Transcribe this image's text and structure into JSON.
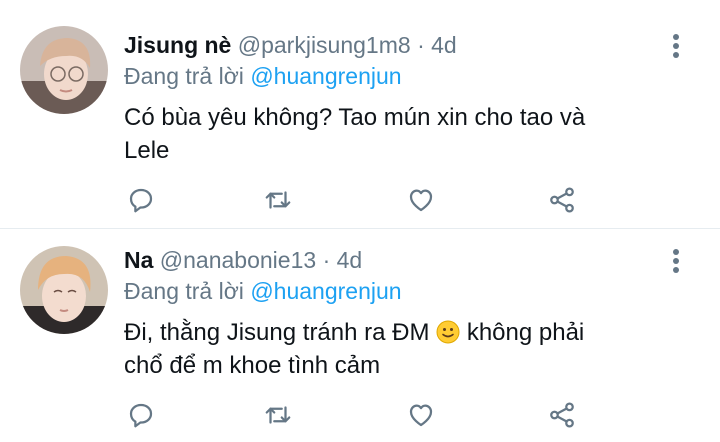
{
  "tweets": [
    {
      "display_name": "Jisung nè",
      "handle": "@parkjisung1m8",
      "separator": "·",
      "time": "4d",
      "reply_prefix": "Đang trả lời",
      "reply_to": "@huangrenjun",
      "text_lines": [
        "Có bùa yêu không? Tao mún xin cho tao và",
        "Lele"
      ],
      "avatar_icon": "avatar-photo"
    },
    {
      "display_name": "Na",
      "handle": "@nanabonie13",
      "separator": "·",
      "time": "4d",
      "reply_prefix": "Đang trả lời",
      "reply_to": "@huangrenjun",
      "text_line1_before_emoji": "Đi, thằng Jisung tránh ra ĐM",
      "text_line1_after_emoji": " không phải",
      "text_line2": "chổ để m khoe tình cảm",
      "emoji": "slightly-smiling-face",
      "avatar_icon": "avatar-photo"
    }
  ],
  "action_icons": [
    "reply-icon",
    "retweet-icon",
    "like-icon",
    "share-icon"
  ],
  "colors": {
    "text": "#0f1419",
    "secondary": "#657786",
    "mention": "#1da1f2",
    "divider": "#e6ecf0"
  }
}
